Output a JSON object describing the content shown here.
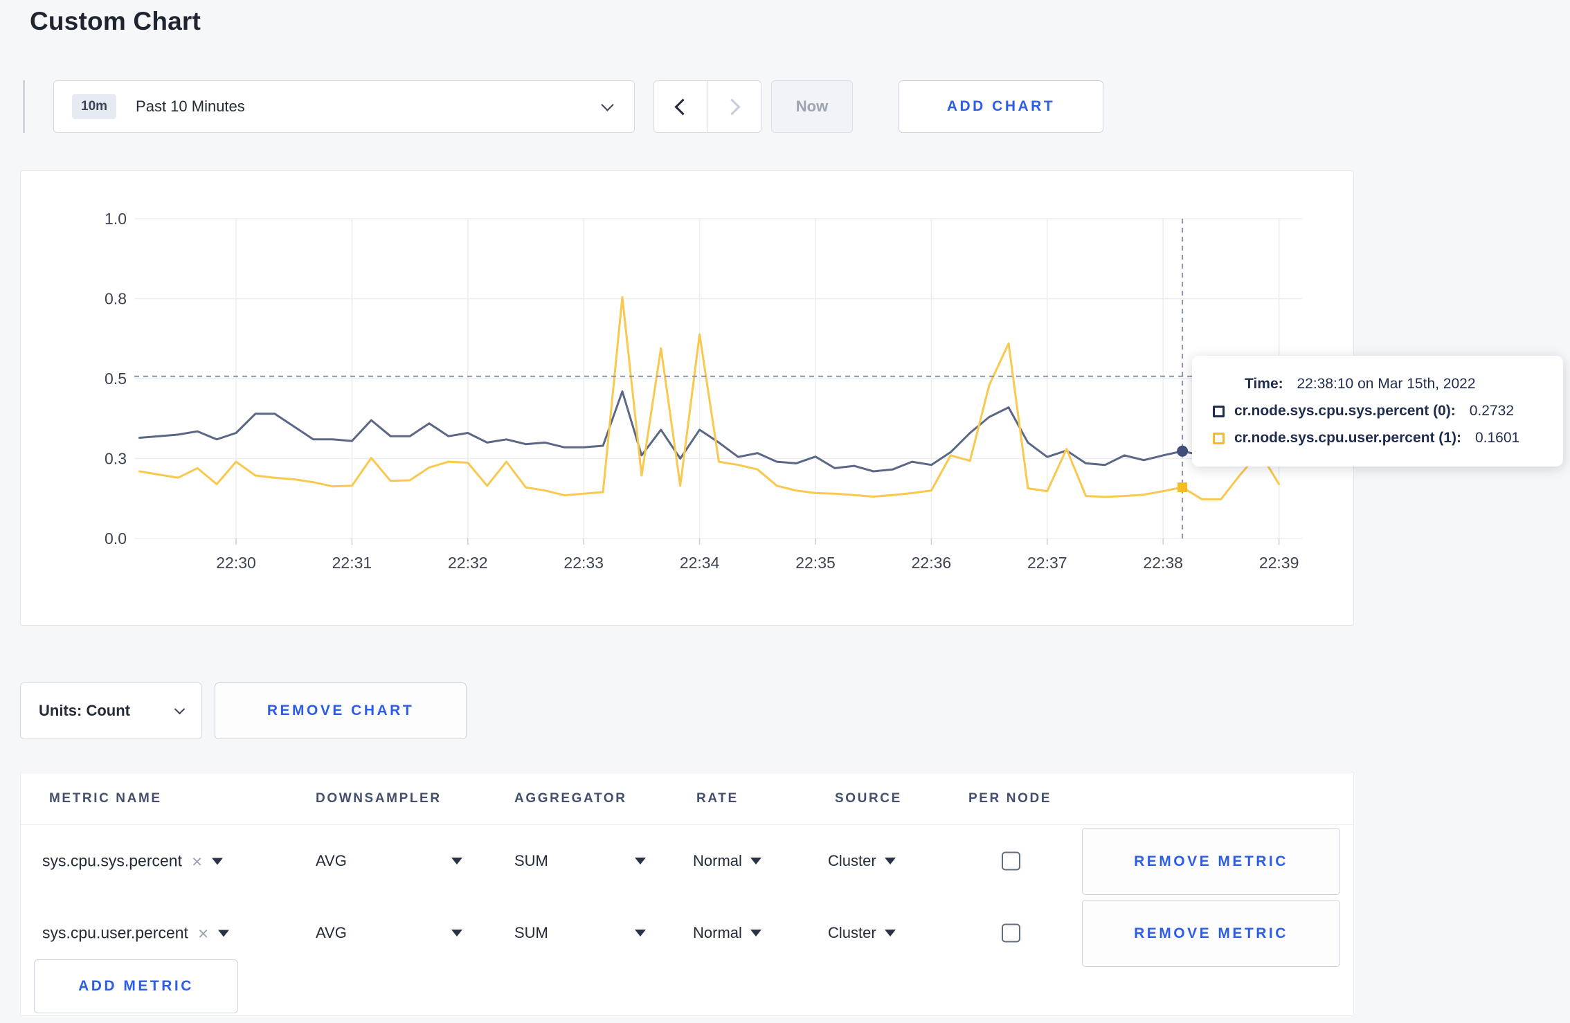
{
  "page": {
    "title": "Custom Chart",
    "background": "#f6f7f9",
    "accent_blue": "#2b5de8"
  },
  "toolbar": {
    "time_range": {
      "badge": "10m",
      "label": "Past 10 Minutes"
    },
    "now_label": "Now",
    "add_chart_label": "ADD CHART"
  },
  "tooltip": {
    "time_label": "Time:",
    "time_value": "22:38:10 on Mar 15th, 2022",
    "rows": [
      {
        "name": "cr.node.sys.cpu.sys.percent (0):",
        "value": "0.2732",
        "swatch_color": "#1f2c4d"
      },
      {
        "name": "cr.node.sys.cpu.user.percent (1):",
        "value": "0.1601",
        "swatch_color": "#f5bd1f"
      }
    ]
  },
  "chart_controls": {
    "units_label": "Units: Count",
    "remove_chart_label": "REMOVE CHART"
  },
  "metrics_table": {
    "headers": [
      "METRIC NAME",
      "DOWNSAMPLER",
      "AGGREGATOR",
      "RATE",
      "SOURCE",
      "PER NODE"
    ],
    "rows": [
      {
        "metric": "sys.cpu.sys.percent",
        "downsampler": "AVG",
        "aggregator": "SUM",
        "rate": "Normal",
        "source": "Cluster",
        "per_node_checked": false,
        "remove_label": "REMOVE METRIC"
      },
      {
        "metric": "sys.cpu.user.percent",
        "downsampler": "AVG",
        "aggregator": "SUM",
        "rate": "Normal",
        "source": "Cluster",
        "per_node_checked": false,
        "remove_label": "REMOVE METRIC"
      }
    ],
    "add_metric_label": "ADD METRIC"
  },
  "icons": {
    "close": "×"
  },
  "chart_data": {
    "type": "line",
    "title": "",
    "xlabel": "",
    "ylabel": "",
    "ylim": [
      0,
      1
    ],
    "grid": true,
    "legend_position": "tooltip",
    "x_ticks": [
      "22:30",
      "22:31",
      "22:32",
      "22:33",
      "22:34",
      "22:35",
      "22:36",
      "22:37",
      "22:38",
      "22:39"
    ],
    "y_ticks": [
      "0.0",
      "0.3",
      "0.5",
      "0.8",
      "1.0"
    ],
    "y_tick_values": [
      0,
      0.25,
      0.5,
      0.75,
      1.0
    ],
    "start_offset_seconds": -50,
    "sample_interval_seconds": 10,
    "series": [
      {
        "name": "cr.node.sys.cpu.sys.percent",
        "color": "#5b6885",
        "values": [
          0.315,
          0.32,
          0.325,
          0.335,
          0.31,
          0.33,
          0.39,
          0.39,
          0.35,
          0.31,
          0.31,
          0.305,
          0.37,
          0.32,
          0.32,
          0.36,
          0.32,
          0.33,
          0.3,
          0.31,
          0.295,
          0.3,
          0.285,
          0.285,
          0.29,
          0.46,
          0.26,
          0.34,
          0.25,
          0.34,
          0.3,
          0.255,
          0.267,
          0.24,
          0.235,
          0.256,
          0.22,
          0.227,
          0.21,
          0.216,
          0.24,
          0.23,
          0.27,
          0.33,
          0.38,
          0.41,
          0.3,
          0.255,
          0.275,
          0.235,
          0.23,
          0.26,
          0.245,
          0.26,
          0.2732,
          0.26,
          0.27,
          0.26,
          0.28,
          0.26
        ]
      },
      {
        "name": "cr.node.sys.cpu.user.percent",
        "color": "#f8c94e",
        "values": [
          0.21,
          0.2,
          0.19,
          0.22,
          0.17,
          0.24,
          0.197,
          0.19,
          0.185,
          0.176,
          0.163,
          0.165,
          0.252,
          0.18,
          0.182,
          0.222,
          0.24,
          0.237,
          0.165,
          0.24,
          0.16,
          0.15,
          0.135,
          0.14,
          0.145,
          0.755,
          0.197,
          0.595,
          0.165,
          0.638,
          0.24,
          0.23,
          0.216,
          0.165,
          0.15,
          0.142,
          0.14,
          0.136,
          0.131,
          0.136,
          0.142,
          0.15,
          0.26,
          0.243,
          0.48,
          0.61,
          0.157,
          0.148,
          0.28,
          0.133,
          0.13,
          0.133,
          0.137,
          0.148,
          0.1601,
          0.123,
          0.123,
          0.2,
          0.27,
          0.17
        ]
      }
    ],
    "hover": {
      "time": "22:38:10",
      "offset_seconds": 490,
      "crosshair_value": 0.507,
      "values": [
        0.2732,
        0.1601
      ],
      "marker_colors": [
        "#40507a",
        "#f5bd1f"
      ]
    }
  }
}
